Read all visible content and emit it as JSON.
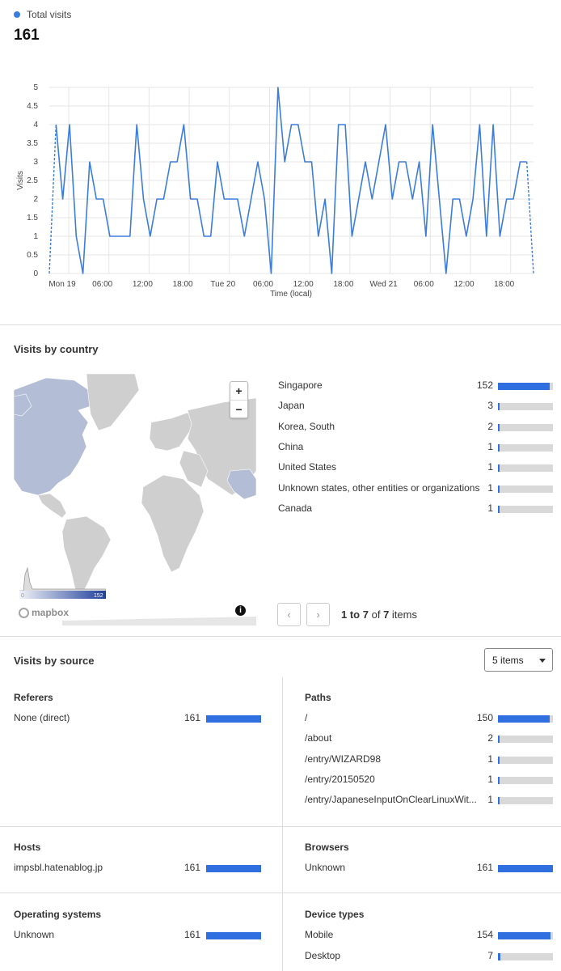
{
  "visits": {
    "legend_label": "Total visits",
    "total": "161",
    "accent_color": "#3b7ddd"
  },
  "chart_data": {
    "type": "line",
    "ylabel": "Visits",
    "xlabel": "Time (local)",
    "ylim": [
      0,
      5
    ],
    "yticks": [
      "0",
      "0.5",
      "1",
      "1.5",
      "2",
      "2.5",
      "3",
      "3.5",
      "4",
      "4.5",
      "5"
    ],
    "xticks": [
      "Mon 19",
      "06:00",
      "12:00",
      "18:00",
      "Tue 20",
      "06:00",
      "12:00",
      "18:00",
      "Wed 21",
      "06:00",
      "12:00",
      "18:00"
    ],
    "grid": true,
    "series": [
      {
        "values": [
          0,
          4,
          2,
          4,
          1,
          0,
          3,
          2,
          2,
          1,
          1,
          1,
          1,
          4,
          2,
          1,
          2,
          2,
          3,
          3,
          4,
          2,
          2,
          1,
          1,
          3,
          2,
          2,
          2,
          1,
          2,
          3,
          2,
          0,
          5,
          3,
          4,
          4,
          3,
          3,
          1,
          2,
          0,
          4,
          4,
          1,
          2,
          3,
          2,
          3,
          4,
          2,
          3,
          3,
          2,
          3,
          1,
          4,
          2,
          0,
          2,
          2,
          1,
          2,
          4,
          1,
          4,
          1,
          2,
          2,
          3,
          3,
          0
        ]
      }
    ]
  },
  "country": {
    "title": "Visits by country",
    "items": [
      {
        "name": "Singapore",
        "value": "152",
        "fraction": 0.94
      },
      {
        "name": "Japan",
        "value": "3",
        "fraction": 0.02
      },
      {
        "name": "Korea, South",
        "value": "2",
        "fraction": 0.013
      },
      {
        "name": "China",
        "value": "1",
        "fraction": 0.007
      },
      {
        "name": "United States",
        "value": "1",
        "fraction": 0.007
      },
      {
        "name": "Unknown states, other entities or organizations",
        "value": "1",
        "fraction": 0.007
      },
      {
        "name": "Canada",
        "value": "1",
        "fraction": 0.007
      }
    ],
    "map_legend_min": "0",
    "map_legend_max": "152",
    "mapbox_label": "mapbox",
    "zoom_in": "+",
    "zoom_out": "−",
    "info": "i",
    "pager_prev": "‹",
    "pager_next": "›",
    "pager_range": "1 to 7",
    "pager_of": "of",
    "pager_total": "7",
    "pager_items": "items"
  },
  "source": {
    "title": "Visits by source",
    "dropdown_value": "5 items",
    "referers": {
      "title": "Referers",
      "items": [
        {
          "name": "None (direct)",
          "value": "161",
          "fraction": 1.0
        }
      ]
    },
    "paths": {
      "title": "Paths",
      "items": [
        {
          "name": "/",
          "value": "150",
          "fraction": 0.94
        },
        {
          "name": "/about",
          "value": "2",
          "fraction": 0.013
        },
        {
          "name": "/entry/WIZARD98",
          "value": "1",
          "fraction": 0.007
        },
        {
          "name": "/entry/20150520",
          "value": "1",
          "fraction": 0.007
        },
        {
          "name": "/entry/JapaneseInputOnClearLinuxWit...",
          "value": "1",
          "fraction": 0.007
        }
      ]
    },
    "hosts": {
      "title": "Hosts",
      "items": [
        {
          "name": "impsbl.hatenablog.jp",
          "value": "161",
          "fraction": 1.0
        }
      ]
    },
    "browsers": {
      "title": "Browsers",
      "items": [
        {
          "name": "Unknown",
          "value": "161",
          "fraction": 1.0
        }
      ]
    },
    "os": {
      "title": "Operating systems",
      "items": [
        {
          "name": "Unknown",
          "value": "161",
          "fraction": 1.0
        }
      ]
    },
    "devices": {
      "title": "Device types",
      "items": [
        {
          "name": "Mobile",
          "value": "154",
          "fraction": 0.96
        },
        {
          "name": "Desktop",
          "value": "7",
          "fraction": 0.04
        }
      ]
    }
  }
}
